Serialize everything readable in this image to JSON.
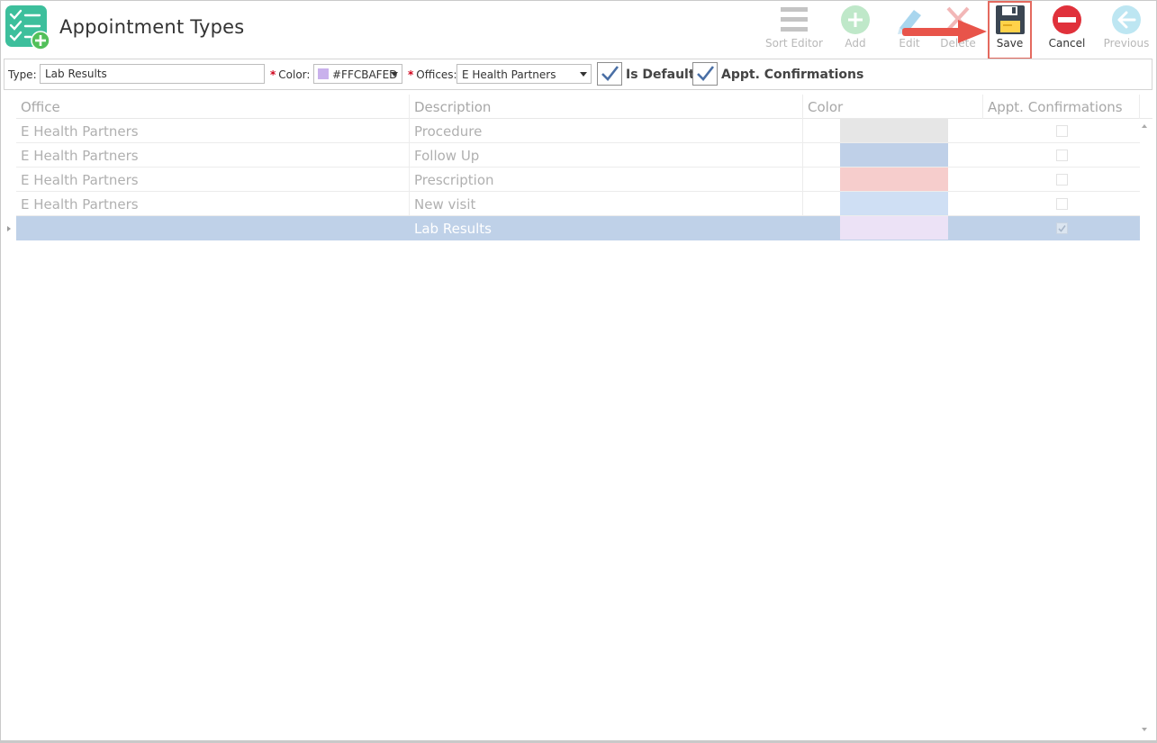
{
  "page": {
    "title": "Appointment Types"
  },
  "toolbar": {
    "sort_editor": "Sort Editor",
    "add": "Add",
    "edit": "Edit",
    "delete": "Delete",
    "save": "Save",
    "cancel": "Cancel",
    "previous": "Previous"
  },
  "form": {
    "type_label": "Type:",
    "type_value": "Lab Results",
    "required_marker": "*",
    "color_label": "Color:",
    "color_value": "#FFCBAFED",
    "offices_label": "Offices:",
    "offices_value": "E Health Partners",
    "is_default_label": "Is Default",
    "is_default_checked": true,
    "appt_confirmations_label": "Appt. Confirmations",
    "appt_confirmations_checked": true
  },
  "grid": {
    "columns": [
      "Office",
      "Description",
      "Color",
      "Appt. Confirmations"
    ],
    "rows": [
      {
        "office": "E Health Partners",
        "description": "Procedure",
        "color": "#e6e6e6",
        "confirm": false
      },
      {
        "office": "E Health Partners",
        "description": "Follow Up",
        "color": "#bfd0e8",
        "confirm": false
      },
      {
        "office": "E Health Partners",
        "description": "Prescription",
        "color": "#f6cdcc",
        "confirm": false
      },
      {
        "office": "E Health Partners",
        "description": "New visit",
        "color": "#cfdff4",
        "confirm": false
      },
      {
        "office": "",
        "description": "Lab Results",
        "color": "#ece2f6",
        "confirm": true,
        "selected": true
      }
    ]
  },
  "colors": {
    "accent_teal": "#3dbf9c",
    "save_highlight": "#e46a5f",
    "selected_row": "#bfd1e8",
    "cancel_red": "#e0313b"
  },
  "icons": {
    "app": "checklist-add-icon",
    "sort_editor": "hamburger-icon",
    "add": "plus-circle-icon",
    "edit": "pencil-icon",
    "delete": "x-icon",
    "save": "floppy-disk-icon",
    "cancel": "minus-circle-icon",
    "previous": "arrow-left-circle-icon"
  }
}
